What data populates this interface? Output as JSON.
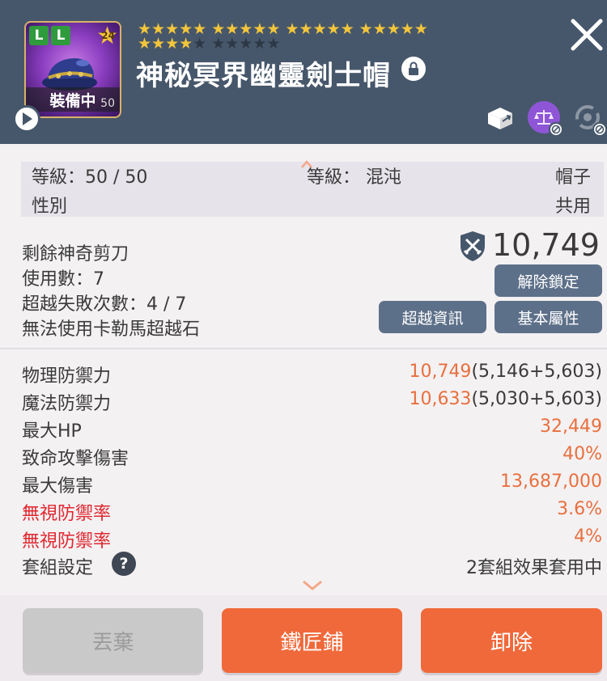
{
  "header": {
    "badges": [
      "L",
      "L"
    ],
    "star_level": "24",
    "equipped_label": "裝備中",
    "equipped_level": "50",
    "stars_filled": 20,
    "stars_total": 30,
    "item_name": "神秘冥界幽靈劍士帽",
    "icons": [
      "lock-icon",
      "close-icon",
      "box-arrow-icon",
      "scale-icon",
      "cycle-icon",
      "play-icon"
    ]
  },
  "info": {
    "level_label": "等級：50 / 50",
    "chaos_label": "等級： 混沌",
    "type_value": "帽子",
    "gender_label": "性別",
    "gender_value": "共用"
  },
  "scissors": {
    "remaining_label": "剩餘神奇剪刀",
    "usage_label": "使用數：7",
    "transcend_fail_label": "超越失敗次數：4 / 7",
    "kalema_label": "無法使用卡勒馬超越石",
    "power_value": "10,749",
    "unlock_button": "解除鎖定",
    "transcend_info_button": "超越資訊",
    "base_attr_button": "基本屬性"
  },
  "stats": [
    {
      "label": "物理防禦力",
      "value": "10,749",
      "detail": "(5,146+5,603)",
      "red": false
    },
    {
      "label": "魔法防禦力",
      "value": "10,633",
      "detail": "(5,030+5,603)",
      "red": false
    },
    {
      "label": "最大HP",
      "value": "32,449",
      "detail": "",
      "red": false
    },
    {
      "label": "致命攻擊傷害",
      "value": "40%",
      "detail": "",
      "red": false
    },
    {
      "label": "最大傷害",
      "value": "13,687,000",
      "detail": "",
      "red": false
    },
    {
      "label": "無視防禦率",
      "value": "3.6%",
      "detail": "",
      "red": true
    },
    {
      "label": "無視防禦率",
      "value": "4%",
      "detail": "",
      "red": true
    }
  ],
  "set": {
    "label": "套組設定",
    "help": "?",
    "value": "2套組效果套用中"
  },
  "buttons": {
    "discard": "丟棄",
    "blacksmith": "鐵匠鋪",
    "unequip": "卸除"
  },
  "colors": {
    "header_bg": "#47576b",
    "accent_orange": "#f0693a",
    "stat_orange": "#e8703e",
    "warn_red": "#e0272f",
    "pill_blue": "#5d7089"
  }
}
